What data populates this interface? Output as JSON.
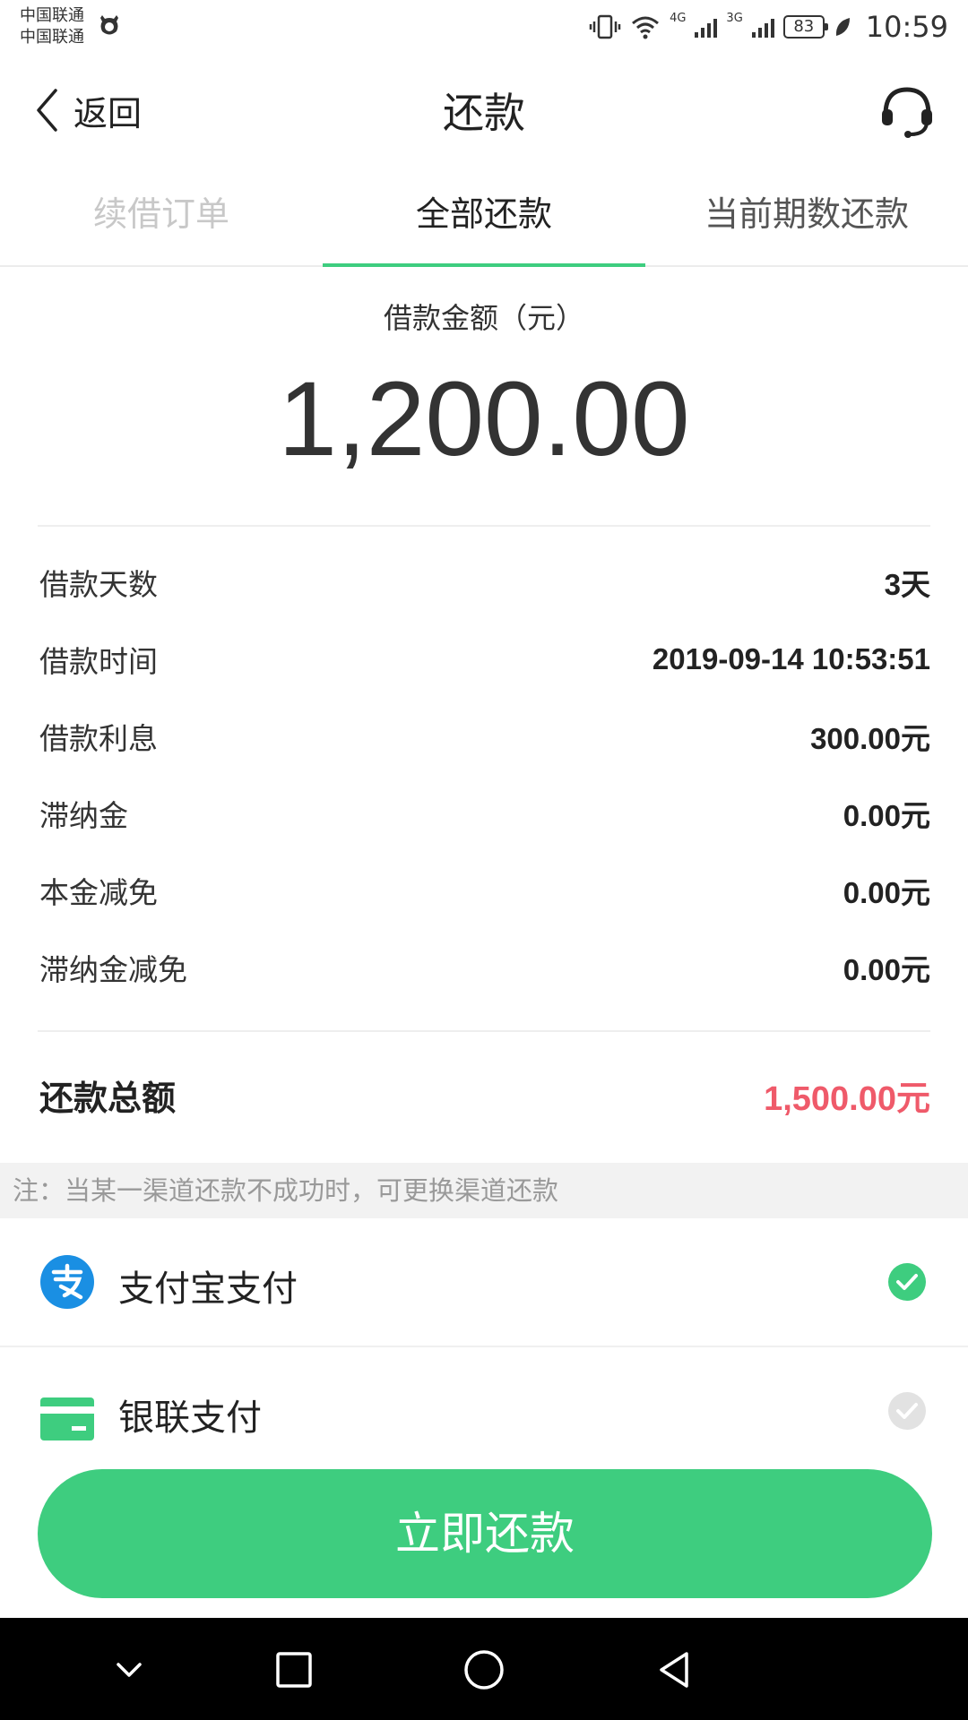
{
  "status_bar": {
    "carrier_1": "中国联通",
    "carrier_2": "中国联通",
    "network_1": "4G",
    "network_2": "3G",
    "battery": "83",
    "time": "10:59"
  },
  "nav": {
    "back_label": "返回",
    "title": "还款",
    "support_icon": "headset-icon"
  },
  "tabs": [
    {
      "label": "续借订单",
      "state": "disabled"
    },
    {
      "label": "全部还款",
      "state": "active"
    },
    {
      "label": "当前期数还款",
      "state": "inactive"
    }
  ],
  "amount": {
    "label": "借款金额（元）",
    "value": "1,200.00"
  },
  "details": [
    {
      "label": "借款天数",
      "value": "3天"
    },
    {
      "label": "借款时间",
      "value": "2019-09-14 10:53:51"
    },
    {
      "label": "借款利息",
      "value": "300.00元"
    },
    {
      "label": "滞纳金",
      "value": "0.00元"
    },
    {
      "label": "本金减免",
      "value": "0.00元"
    },
    {
      "label": "滞纳金减免",
      "value": "0.00元"
    }
  ],
  "total": {
    "label": "还款总额",
    "value": "1,500.00元"
  },
  "note": "注：当某一渠道还款不成功时，可更换渠道还款",
  "payment_methods": [
    {
      "label": "支付宝支付",
      "icon": "alipay-icon",
      "selected": true
    },
    {
      "label": "银联支付",
      "icon": "card-icon",
      "selected": false
    }
  ],
  "submit_label": "立即还款",
  "colors": {
    "accent": "#3ecd7f",
    "total": "#ef5a6a",
    "alipay": "#1a8fe3"
  }
}
